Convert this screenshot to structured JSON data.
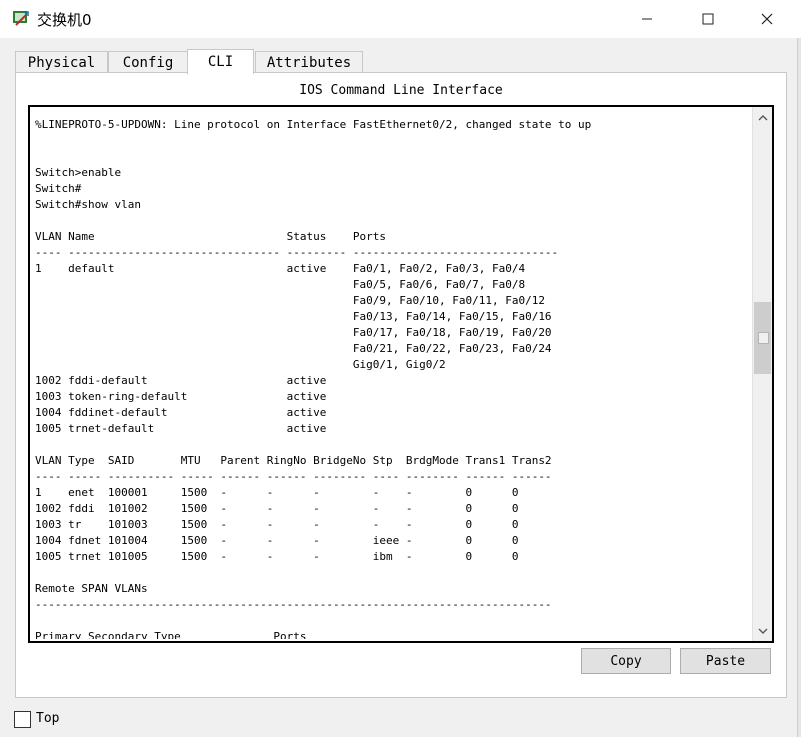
{
  "window": {
    "title": "交换机0"
  },
  "tabs": [
    {
      "label": "Physical"
    },
    {
      "label": "Config"
    },
    {
      "label": "CLI"
    },
    {
      "label": "Attributes"
    }
  ],
  "cli": {
    "heading": "IOS Command Line Interface",
    "lines": [
      "%LINEPROTO-5-UPDOWN: Line protocol on Interface FastEthernet0/2, changed state to up",
      "",
      "",
      "Switch>enable",
      "Switch#",
      "Switch#show vlan",
      "",
      "VLAN Name                             Status    Ports",
      "---- -------------------------------- --------- -------------------------------",
      "1    default                          active    Fa0/1, Fa0/2, Fa0/3, Fa0/4",
      "                                                Fa0/5, Fa0/6, Fa0/7, Fa0/8",
      "                                                Fa0/9, Fa0/10, Fa0/11, Fa0/12",
      "                                                Fa0/13, Fa0/14, Fa0/15, Fa0/16",
      "                                                Fa0/17, Fa0/18, Fa0/19, Fa0/20",
      "                                                Fa0/21, Fa0/22, Fa0/23, Fa0/24",
      "                                                Gig0/1, Gig0/2",
      "1002 fddi-default                     active",
      "1003 token-ring-default               active",
      "1004 fddinet-default                  active",
      "1005 trnet-default                    active",
      "",
      "VLAN Type  SAID       MTU   Parent RingNo BridgeNo Stp  BrdgMode Trans1 Trans2",
      "---- ----- ---------- ----- ------ ------ -------- ---- -------- ------ ------",
      "1    enet  100001     1500  -      -      -        -    -        0      0",
      "1002 fddi  101002     1500  -      -      -        -    -        0      0",
      "1003 tr    101003     1500  -      -      -        -    -        0      0",
      "1004 fdnet 101004     1500  -      -      -        ieee -        0      0",
      "1005 trnet 101005     1500  -      -      -        ibm  -        0      0",
      "",
      "Remote SPAN VLANs",
      "------------------------------------------------------------------------------",
      "",
      "Primary Secondary Type              Ports"
    ]
  },
  "buttons": {
    "copy": "Copy",
    "paste": "Paste"
  },
  "footer": {
    "top_label": "Top",
    "top_checked": false
  },
  "icons": {
    "app": "switch-app-icon",
    "minimize": "minimize-icon",
    "maximize": "maximize-icon",
    "close": "close-icon",
    "scroll_up": "chevron-up-icon",
    "scroll_down": "chevron-down-icon"
  }
}
